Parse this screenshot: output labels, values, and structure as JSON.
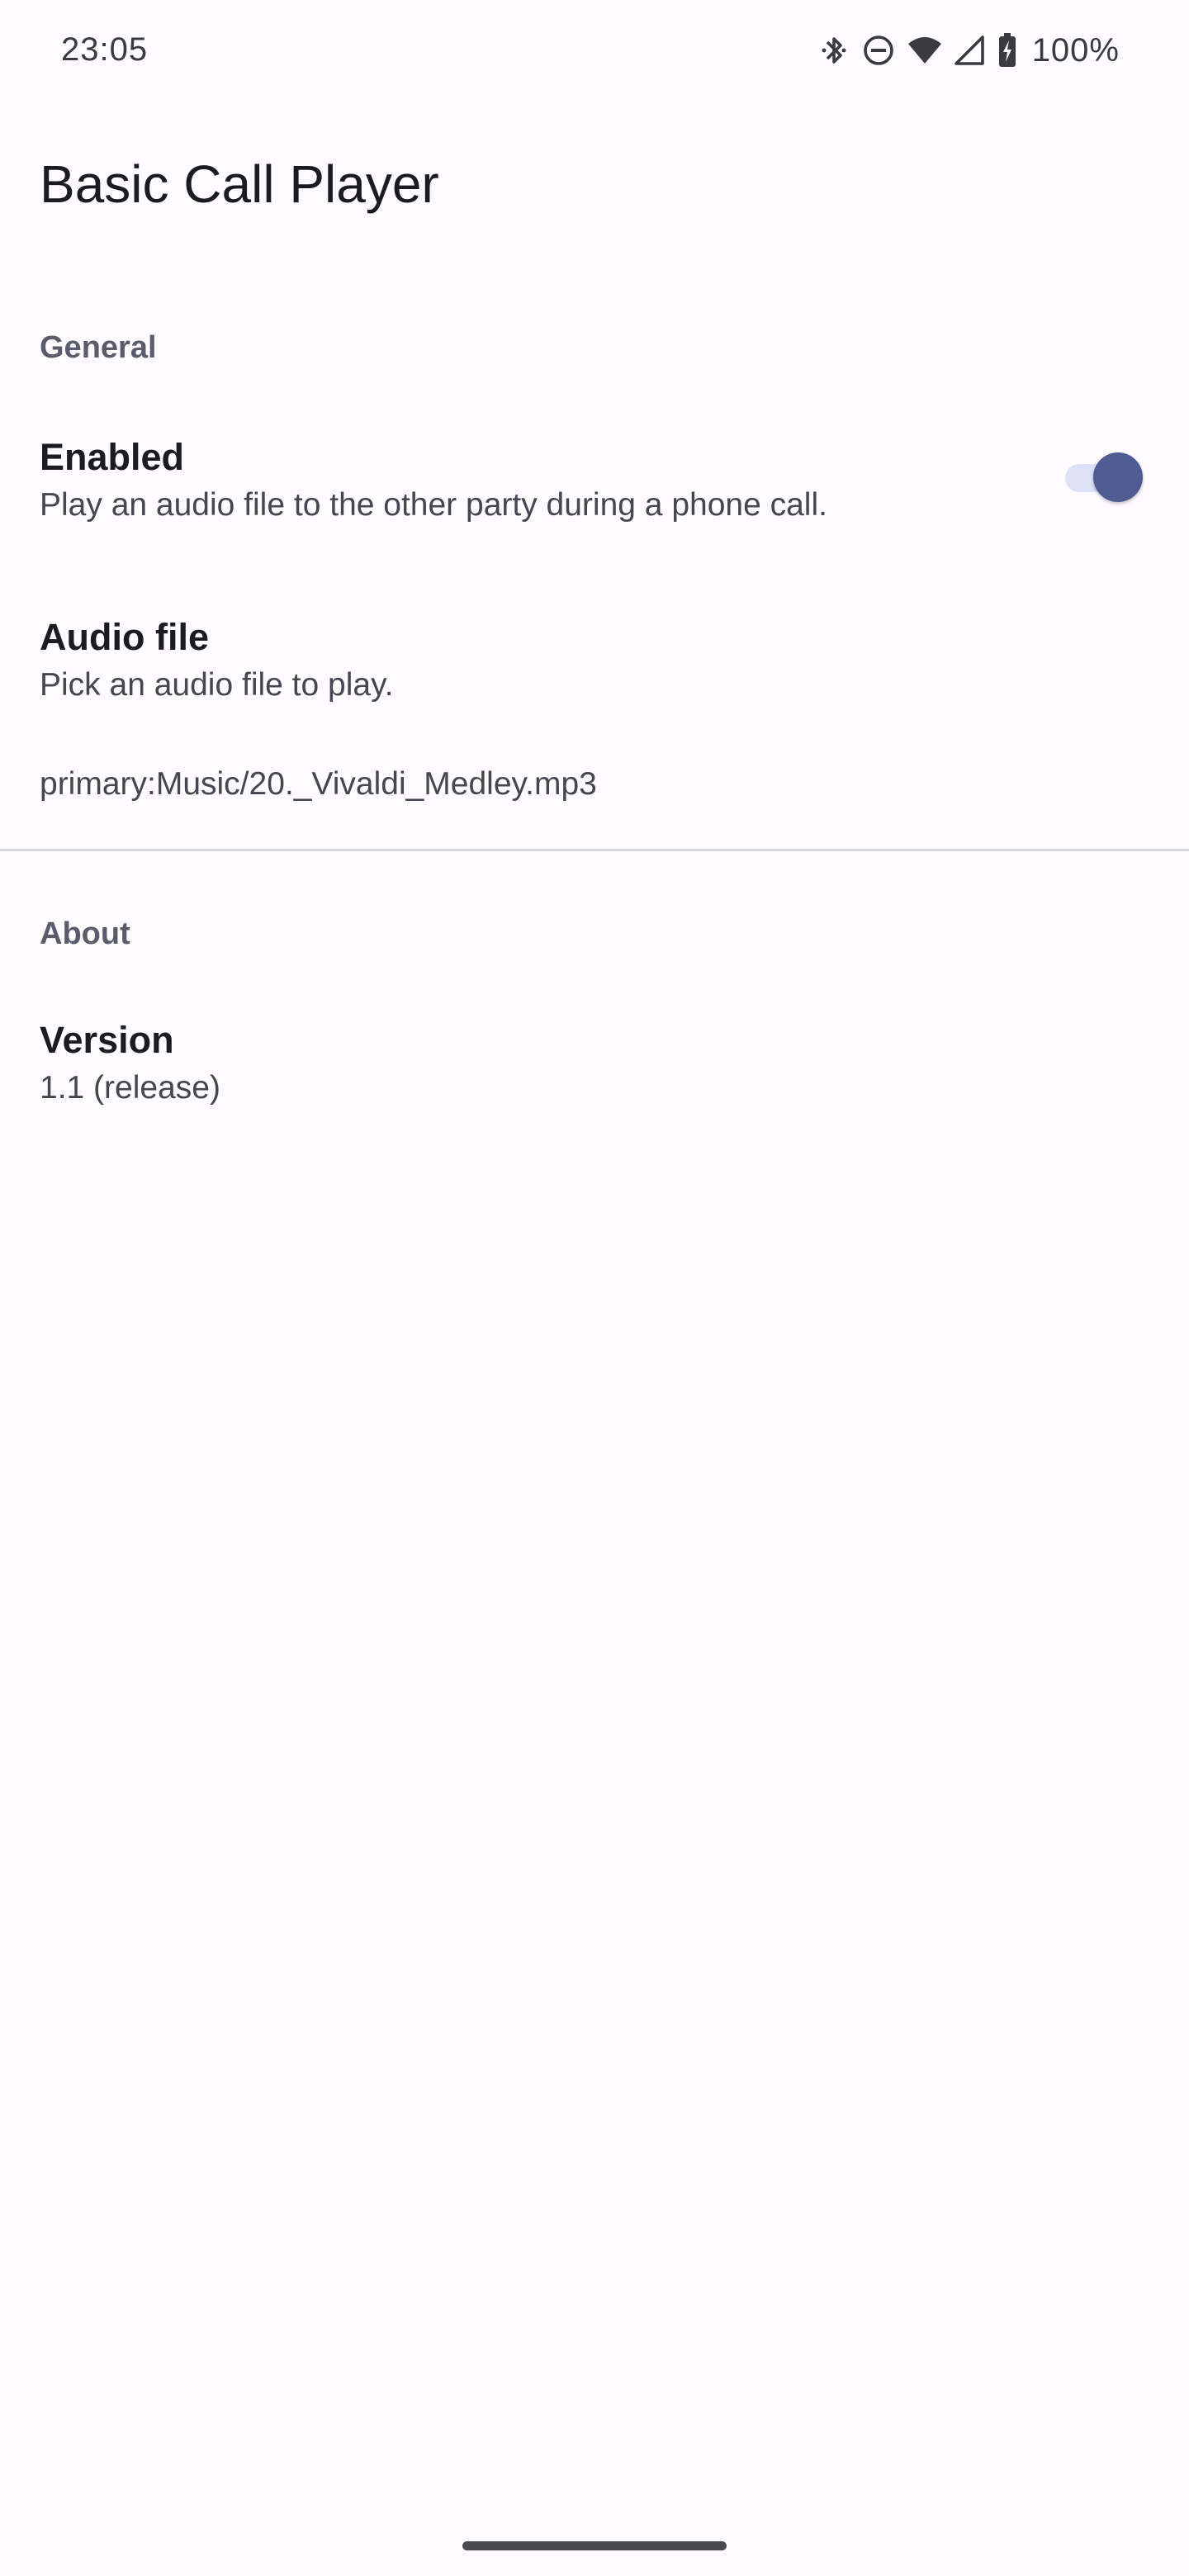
{
  "status_bar": {
    "time": "23:05",
    "battery": "100%",
    "icons": [
      "bluetooth-icon",
      "do-not-disturb-icon",
      "wifi-icon",
      "cell-signal-icon",
      "battery-charging-icon"
    ]
  },
  "app": {
    "title": "Basic Call Player"
  },
  "sections": {
    "general": {
      "header": "General",
      "enabled": {
        "title": "Enabled",
        "summary": "Play an audio file to the other party during a phone call.",
        "checked": true
      },
      "audio_file": {
        "title": "Audio file",
        "summary": "Pick an audio file to play.",
        "value": "primary:Music/20._Vivaldi_Medley.mp3"
      }
    },
    "about": {
      "header": "About",
      "version": {
        "title": "Version",
        "summary": "1.1 (release)"
      }
    }
  },
  "colors": {
    "background": "#fdfbfe",
    "accent": "#4f5b93",
    "toggle_track": "#dfe1f8",
    "section_header": "#5a5c6b"
  }
}
